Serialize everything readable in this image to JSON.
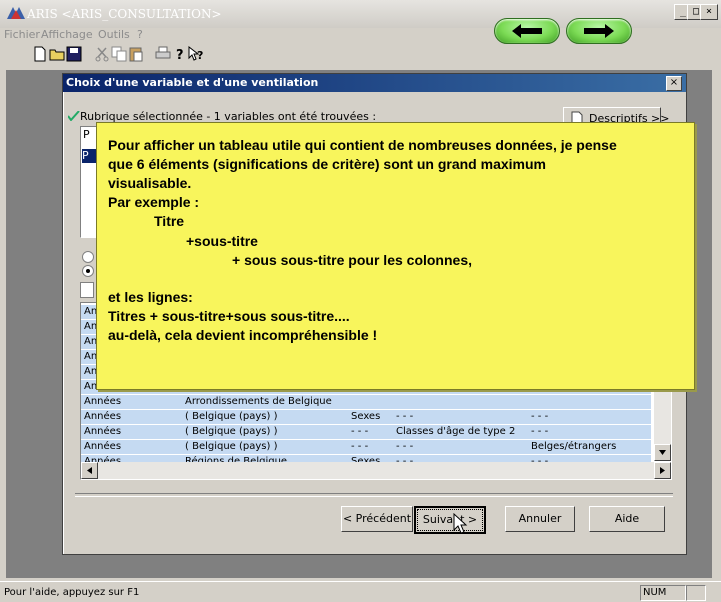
{
  "app": {
    "title": "ARIS <ARIS_CONSULTATION>",
    "menu": [
      "Fichier",
      "Affichage",
      "Outils",
      "?"
    ],
    "toolbar_icons": [
      "new-document-icon",
      "open-folder-icon",
      "save-icon",
      "cut-icon",
      "copy-icon",
      "paste-icon",
      "print-icon",
      "help-icon",
      "context-help-icon"
    ],
    "nav_icons": [
      "back-arrow-icon",
      "forward-arrow-icon"
    ]
  },
  "dialog": {
    "title": "Choix d'une variable et d'une ventilation",
    "close_label": "×",
    "rubrique_text": "Rubrique sélectionnée - 1 variables ont été trouvées :",
    "descriptifs_label": "Descriptifs >>",
    "var_list": {
      "row1": "P",
      "row2": "P"
    }
  },
  "grid": {
    "rows": [
      {
        "c1": "An",
        "c2": "",
        "c3": "",
        "c4": "",
        "c5": ""
      },
      {
        "c1": "An",
        "c2": "",
        "c3": "",
        "c4": "",
        "c5": ""
      },
      {
        "c1": "An",
        "c2": "",
        "c3": "",
        "c4": "",
        "c5": ""
      },
      {
        "c1": "An",
        "c2": "",
        "c3": "",
        "c4": "",
        "c5": ""
      },
      {
        "c1": "An",
        "c2": "",
        "c3": "",
        "c4": "",
        "c5": ""
      },
      {
        "c1": "An",
        "c2": "",
        "c3": "",
        "c4": "",
        "c5": ""
      },
      {
        "c1": "Années",
        "c2": "Arrondissements de Belgique",
        "c3": "",
        "c4": "",
        "c5": ""
      },
      {
        "c1": "Années",
        "c2": "( Belgique (pays) )",
        "c3": "Sexes",
        "c4": "- - -",
        "c5": "- - -"
      },
      {
        "c1": "Années",
        "c2": "( Belgique (pays) )",
        "c3": "- - -",
        "c4": "Classes d'âge de type 2",
        "c5": "- - -"
      },
      {
        "c1": "Années",
        "c2": "( Belgique (pays) )",
        "c3": "- - -",
        "c4": "- - -",
        "c5": "Belges/étrangers"
      },
      {
        "c1": "Années",
        "c2": "Régions de Belgique",
        "c3": "Sexes",
        "c4": "- - -",
        "c5": "- - -"
      }
    ]
  },
  "buttons": {
    "precedent": "< Précédent",
    "suivant": "Suivant >",
    "annuler": "Annuler",
    "aide": "Aide"
  },
  "note": {
    "lines": [
      "Pour afficher un tableau utile qui contient de nombreuses données, je pense",
      "que 6 éléments (significations de critère) sont un grand maximum",
      "visualisable.",
      "Par exemple :",
      "Titre",
      "+sous-titre",
      "+ sous sous-titre pour les colonnes,",
      "et les lignes:",
      "Titres + sous-titre+sous sous-titre....",
      "au-delà, cela devient incompréhensible !"
    ]
  },
  "status": {
    "help_text": "Pour l'aide, appuyez sur F1",
    "num": "NUM"
  },
  "colors": {
    "dialog_title": "#0a246a",
    "note_bg": "#f8f55c",
    "grid_row": "#c5daf2",
    "nav_button": "#7cdb55"
  }
}
